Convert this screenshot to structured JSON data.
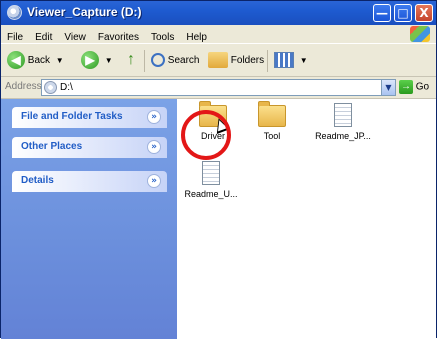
{
  "window": {
    "title": "Viewer_Capture (D:)",
    "buttons": {
      "min": "—",
      "max": "□",
      "close": "X"
    }
  },
  "menu": [
    "File",
    "Edit",
    "View",
    "Favorites",
    "Tools",
    "Help"
  ],
  "toolbar": {
    "back": "Back",
    "search": "Search",
    "folders": "Folders"
  },
  "address": {
    "label": "Address",
    "value": "D:\\",
    "go": "Go"
  },
  "left_pane": {
    "tasks": [
      "File and Folder Tasks",
      "Other Places",
      "Details"
    ]
  },
  "files": [
    {
      "name": "Driver",
      "type": "folder"
    },
    {
      "name": "Tool",
      "type": "folder"
    },
    {
      "name": "Readme_JP...",
      "type": "document"
    },
    {
      "name": "Readme_U...",
      "type": "document"
    }
  ],
  "colors": {
    "titlebar": "#1e5bd0",
    "left_pane": "#6b8fdc",
    "task_title": "#215dc6",
    "highlight": "#e31717"
  }
}
